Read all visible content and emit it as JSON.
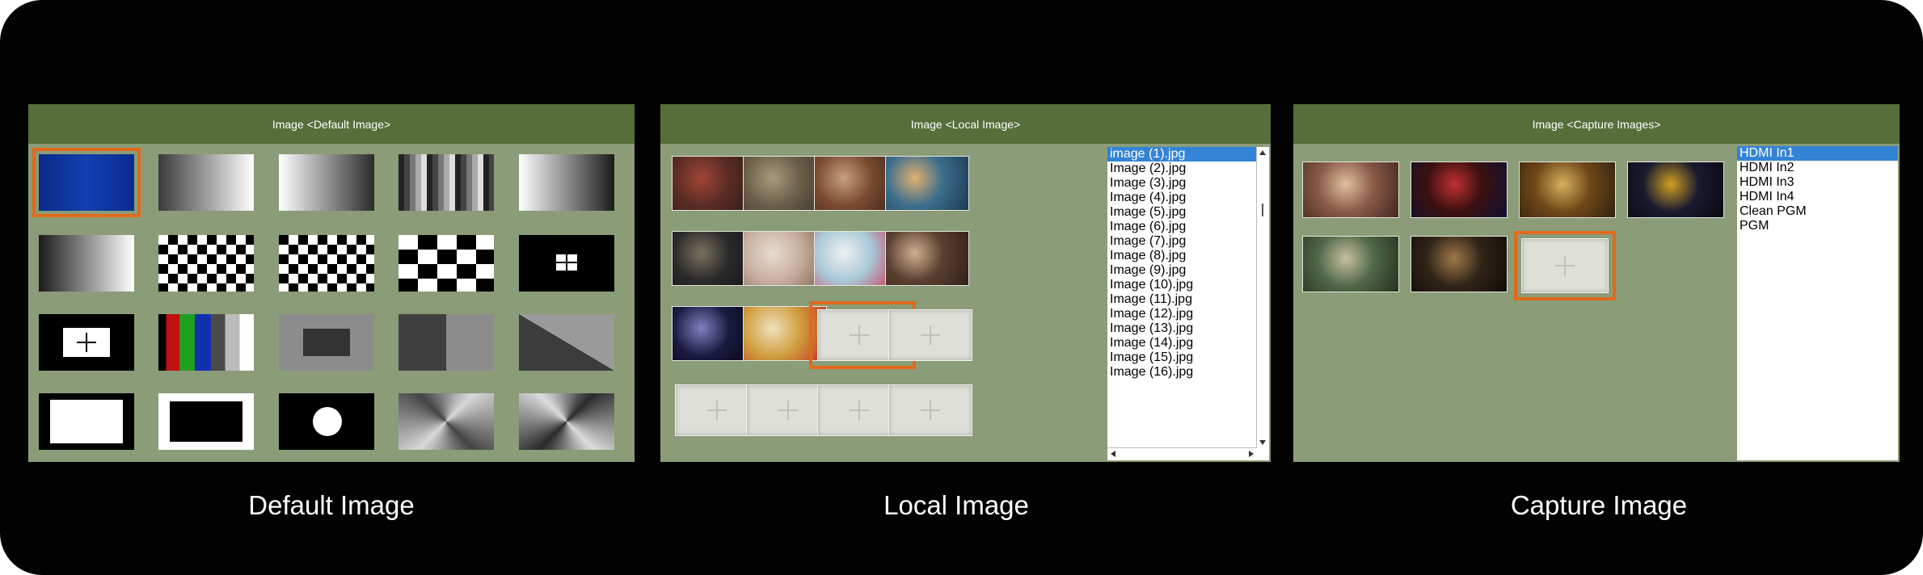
{
  "panels": {
    "default": {
      "title": "Image <Default Image>",
      "caption": "Default Image",
      "patterns": [
        "blue-gradient",
        "gray-ramp-right",
        "gray-ramp-left",
        "gray-steps",
        "gray-ramp-2",
        "gray-ramp-dark",
        "checker-fine",
        "checker-fine-2",
        "checker-coarse",
        "window-cross",
        "center-cross",
        "color-bars",
        "gray-box",
        "gray-split",
        "diagonal-split",
        "white-frame",
        "black-frame",
        "circle",
        "radial-gradient",
        "radial-gradient-dark"
      ]
    },
    "local": {
      "title": "Image <Local Image>",
      "caption": "Local Image",
      "files": [
        "image (1).jpg",
        "Image (2).jpg",
        "Image (3).jpg",
        "Image (4).jpg",
        "Image (5).jpg",
        "Image (6).jpg",
        "Image (7).jpg",
        "Image (8).jpg",
        "Image (9).jpg",
        "Image (10).jpg",
        "Image (11).jpg",
        "Image (12).jpg",
        "Image (13).jpg",
        "Image (14).jpg",
        "Image (15).jpg",
        "Image (16).jpg"
      ]
    },
    "capture": {
      "title": "Image <Capture Images>",
      "caption": "Capture Image",
      "sources": [
        "HDMI In1",
        "HDMI In2",
        "HDMI In3",
        "HDMI In4",
        "Clean PGM",
        "PGM"
      ]
    }
  },
  "colors": {
    "panel_bg": "#8a9c78",
    "header_bg": "#566e3a",
    "selection": "#e06a1a",
    "list_selected": "#3383d6"
  }
}
